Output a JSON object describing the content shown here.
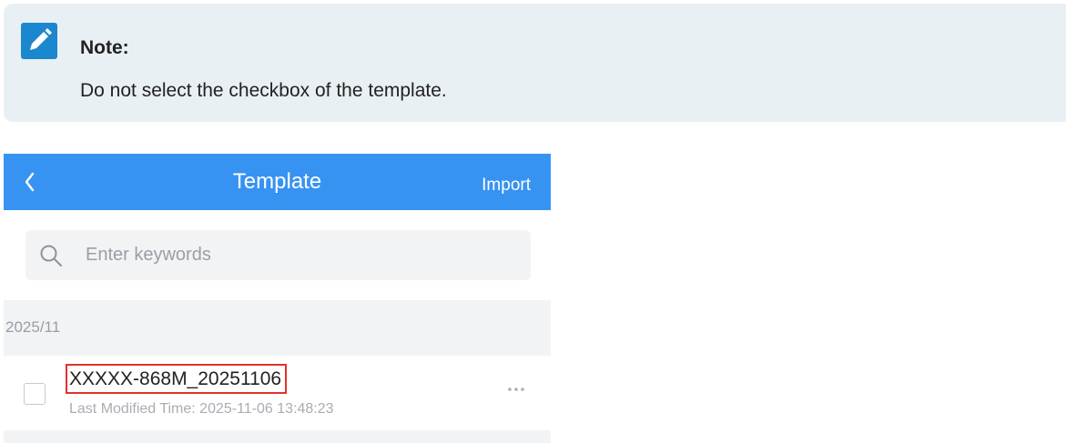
{
  "note": {
    "title": "Note:",
    "text": "Do not select the checkbox of the template.",
    "icon": "pencil-edit-icon",
    "accent": "#1b87cf"
  },
  "navbar": {
    "title": "Template",
    "action_label": "Import",
    "back_icon": "chevron-left-icon",
    "color": "#3793f1"
  },
  "search": {
    "placeholder": "Enter keywords",
    "icon": "search-icon"
  },
  "groups": [
    {
      "label": "2025/11",
      "items": [
        {
          "name": "XXXXX-868M_20251106",
          "subtitle": "Last Modified Time: 2025-11-06 13:48:23",
          "checked": false,
          "highlighted": true,
          "more_icon": "more-horizontal-icon"
        }
      ]
    }
  ],
  "colors": {
    "highlight": "#e0322c",
    "note_bg": "#e9f0f3"
  }
}
